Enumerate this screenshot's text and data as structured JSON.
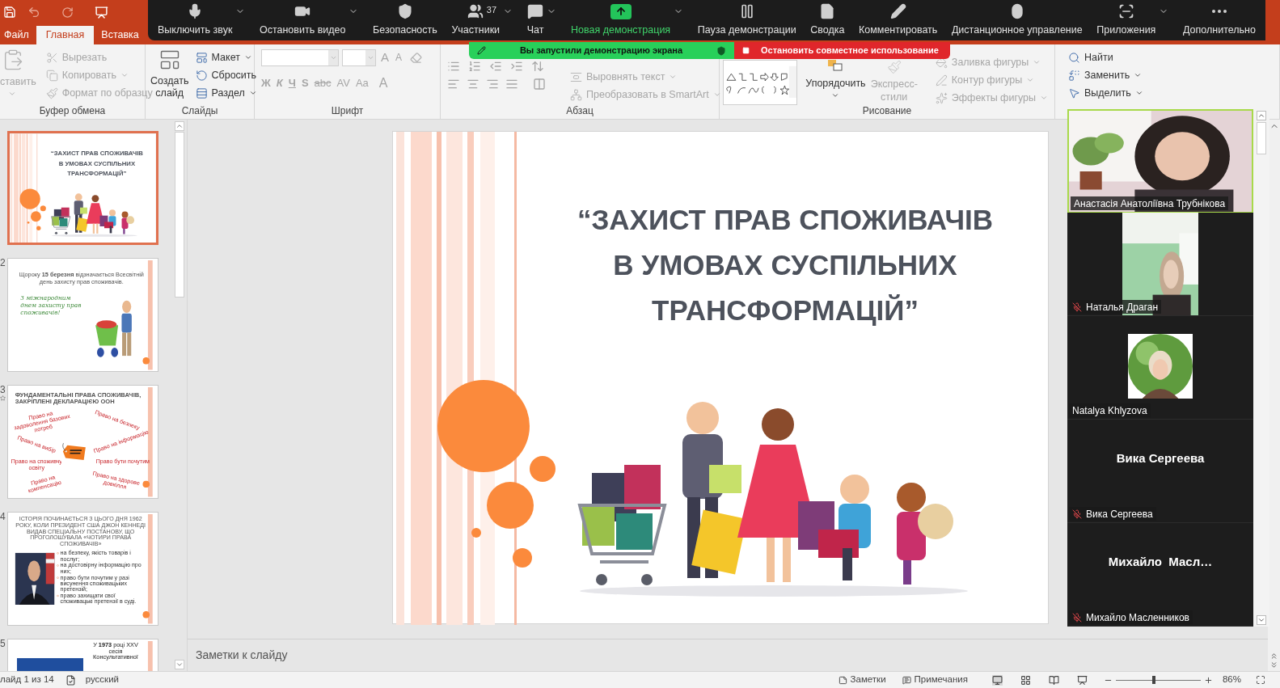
{
  "ribbon_tabs": [
    {
      "label": "Файл",
      "selected": false
    },
    {
      "label": "Главная",
      "selected": true
    },
    {
      "label": "Вставка",
      "selected": false
    }
  ],
  "meeting_toolbar": [
    {
      "label": "Выключить звук",
      "kind": "mic",
      "caret": true
    },
    {
      "label": "Остановить видео",
      "kind": "video",
      "caret": true
    },
    {
      "label": "Безопасность",
      "kind": "security",
      "caret": false
    },
    {
      "label": "Участники",
      "kind": "participants",
      "caret": true,
      "badge": "37"
    },
    {
      "label": "Чат",
      "kind": "chat",
      "caret": true
    },
    {
      "label": "Новая демонстрация",
      "kind": "share",
      "caret": true
    },
    {
      "label": "Пауза демонстрации",
      "kind": "pause",
      "caret": false
    },
    {
      "label": "Сводка",
      "kind": "summary",
      "caret": false
    },
    {
      "label": "Комментировать",
      "kind": "annotate",
      "caret": false
    },
    {
      "label": "Дистанционное управление",
      "kind": "remote",
      "caret": false
    },
    {
      "label": "Приложения",
      "kind": "apps",
      "caret": true
    },
    {
      "label": "Дополнительно",
      "kind": "more",
      "caret": false
    }
  ],
  "share_banner": {
    "status": "Вы запустили демонстрацию экрана",
    "stop": "Остановить совместное использование"
  },
  "ribbon": {
    "clipboard": {
      "title": "Буфер обмена",
      "paste": {
        "label": "ставить",
        "disabled": true
      },
      "items": [
        {
          "label": "Вырезать",
          "disabled": true,
          "caret": false
        },
        {
          "label": "Копировать",
          "disabled": true,
          "caret": true
        },
        {
          "label": "Формат по образцу",
          "disabled": true,
          "caret": false
        }
      ]
    },
    "slides": {
      "title": "Слайды",
      "new_slide": {
        "lines": [
          "Создать",
          "слайд"
        ],
        "disabled": false
      },
      "items": [
        {
          "label": "Макет",
          "disabled": false,
          "caret": true
        },
        {
          "label": "Сбросить",
          "disabled": false,
          "caret": false
        },
        {
          "label": "Раздел",
          "disabled": false,
          "caret": true
        }
      ]
    },
    "font": {
      "title": "Шрифт",
      "size_buttons": [
        "A",
        "A"
      ],
      "format_buttons": [
        "Ж",
        "К",
        "Ч",
        "S",
        "abc",
        "AV",
        "Aa",
        "A"
      ]
    },
    "paragraph": {
      "title": "Абзац",
      "items": [
        {
          "label": "Выровнять текст",
          "disabled": true,
          "caret": true
        },
        {
          "label": "Преобразовать в SmartArt",
          "disabled": true,
          "caret": true
        }
      ]
    },
    "drawing": {
      "title": "Рисование",
      "arrange": {
        "label": "Упорядочить",
        "disabled": false
      },
      "quick_styles": {
        "lines": [
          "Экспресс-",
          "стили"
        ],
        "disabled": true
      },
      "items": [
        {
          "label": "Заливка фигуры",
          "disabled": true,
          "caret": true
        },
        {
          "label": "Контур фигуры",
          "disabled": true,
          "caret": true
        },
        {
          "label": "Эффекты фигуры",
          "disabled": true,
          "caret": true
        }
      ]
    },
    "editing": {
      "items": [
        {
          "label": "Найти",
          "kind": "find",
          "disabled": false,
          "caret": false
        },
        {
          "label": "Заменить",
          "kind": "replace",
          "disabled": false,
          "caret": true
        },
        {
          "label": "Выделить",
          "kind": "select",
          "disabled": false,
          "caret": true
        }
      ]
    }
  },
  "thumbnails": [
    {
      "kind": "title",
      "selected": true,
      "animated": false,
      "title_lines": [
        "“ЗАХИСТ ПРАВ СПОЖИВАЧІВ",
        "В УМОВАХ СУСПІЛЬНИХ",
        "ТРАНСФОРМАЦІЙ”"
      ]
    },
    {
      "number": "2",
      "kind": "intro",
      "selected": false,
      "animated": false,
      "text": "Щороку **15 березня** відзначається Всесвітній день захисту прав споживачів.",
      "greeting": "З міжнародним днем захисту прав споживачів!"
    },
    {
      "number": "3",
      "kind": "rights",
      "selected": false,
      "animated": true,
      "title": "ФУНДАМЕНТАЛЬНІ ПРАВА СПОЖИВАЧІВ, ЗАКРІПЛЕНІ ДЕКЛАРАЦІЄЮ ООН",
      "rights": [
        "Право на задоволення базових потреб",
        "Право на безпеку",
        "Право на вибір",
        "Право на інформацію",
        "Право на споживчу освіту",
        "Право бути почутим",
        "Право на компенсацію",
        "Право на здорове довкілля"
      ]
    },
    {
      "number": "4",
      "kind": "history",
      "selected": false,
      "animated": false,
      "title": "ІСТОРІЯ ПОЧИНАЄТЬСЯ З ЦЬОГО ДНЯ 1962 РОКУ, КОЛИ ПРЕЗИДЕНТ США ДЖОН КЕННЕДІ ВИДАВ СПЕЦІАЛЬНУ ПОСТАНОВУ, ЩО ПРОГОЛОШУВАЛА «ЧОТИРИ ПРАВА СПОЖИВАЧІВ»",
      "bullets": [
        "на безпеку, якість товарів і послуг;",
        "на достовірну інформацію про них;",
        "право бути почутим у разі висунення споживацьких претензій;",
        "право захищати свої споживацькі претензії в суді."
      ]
    },
    {
      "number": "5",
      "kind": "year",
      "selected": false,
      "animated": false,
      "lines": [
        "У **1973** році XXV",
        "сесія",
        "Консультативної"
      ]
    }
  ],
  "slide": {
    "title_lines": [
      "“ЗАХИСТ ПРАВ СПОЖИВАЧІВ",
      "В УМОВАХ СУСПІЛЬНИХ",
      "ТРАНСФОРМАЦІЙ”"
    ]
  },
  "notes": {
    "placeholder": "Заметки к слайду"
  },
  "video_tiles": [
    {
      "kind": "video",
      "name": "Анастасія Анатоліївна Трубнікова",
      "muted": false,
      "active": true
    },
    {
      "kind": "portrait_video",
      "name": "Наталья Драган",
      "muted": true,
      "active": false
    },
    {
      "kind": "avatar",
      "name": "Natalya Khlyzova",
      "muted": false,
      "active": false
    },
    {
      "kind": "name",
      "display_name": "Вика Сергеева",
      "name": "Вика Сергеева",
      "muted": true,
      "active": false
    },
    {
      "kind": "name",
      "display_name": "Михайло  Масл…",
      "name": "Михайло Масленников",
      "muted": true,
      "active": false
    }
  ],
  "status_bar": {
    "slide_counter": "лайд 1 из 14",
    "language": "русский",
    "notes": "Заметки",
    "comments": "Примечания",
    "zoom": "86%",
    "zoom_slider": {
      "level": 0.45
    }
  }
}
